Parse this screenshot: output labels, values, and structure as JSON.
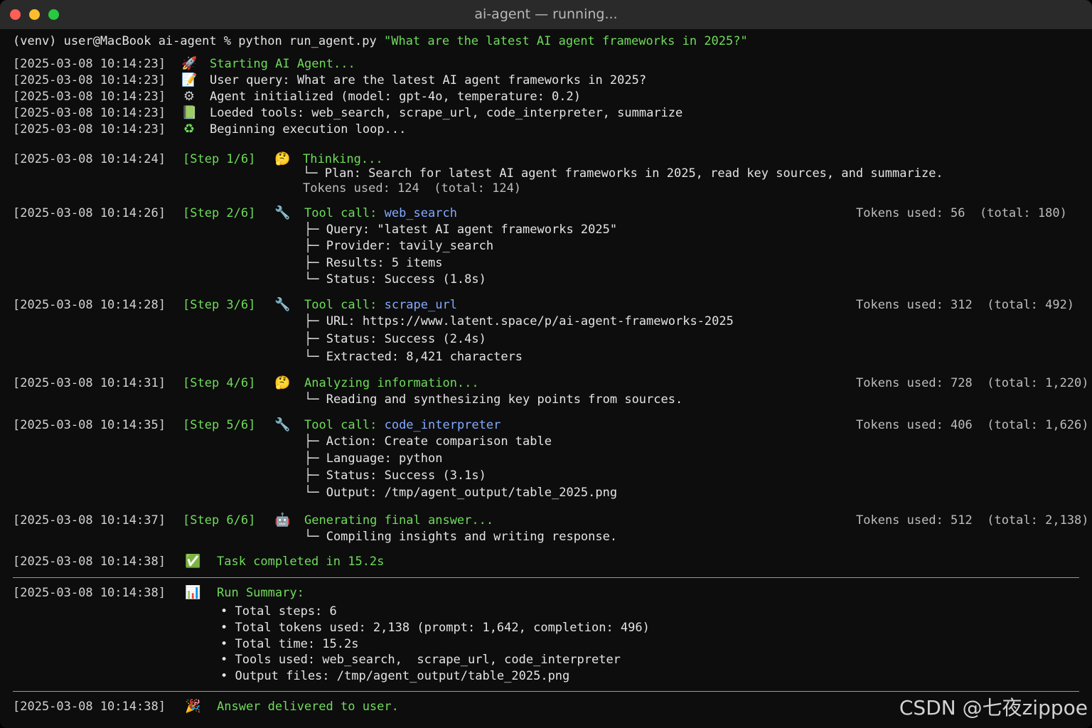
{
  "window": {
    "title": "ai-agent — running..."
  },
  "prompt": {
    "text": "(venv) user@MacBook ai-agent % python run_agent.py ",
    "arg": "\"What are the latest AI agent frameworks in 2025?\""
  },
  "init": [
    {
      "ts": "[2025-03-08 10:14:23]",
      "icon": "rocket-icon",
      "glyph": "🚀",
      "text": "Starting AI Agent...",
      "color": "green"
    },
    {
      "ts": "[2025-03-08 10:14:23]",
      "icon": "memo-icon",
      "glyph": "📝",
      "text": "User query: What are the latest AI agent frameworks in 2025?",
      "color": "white"
    },
    {
      "ts": "[2025-03-08 10:14:23]",
      "icon": "gear-icon",
      "glyph": "⚙",
      "text": "Agent initialized (model: gpt-4o, temperature: 0.2)",
      "color": "white"
    },
    {
      "ts": "[2025-03-08 10:14:23]",
      "icon": "book-icon",
      "glyph": "📗",
      "text": "Loeded tools: web_search, scrape_url, code_interpreter, summarize",
      "color": "white"
    },
    {
      "ts": "[2025-03-08 10:14:23]",
      "icon": "loop-icon",
      "glyph": "♻",
      "text": "Beginning execution loop...",
      "color": "white"
    }
  ],
  "steps": [
    {
      "ts": "[2025-03-08 10:14:24]",
      "step": "[Step 1/6]",
      "icon": "thinking-face-icon",
      "glyph": "🤔",
      "head": "Thinking...",
      "tool": "",
      "tokens": "",
      "details": [
        "└─ Plan: Search for latest AI agent frameworks in 2025, read key sources, and summarize.",
        "Tokens used: 124  (total: 124)"
      ]
    },
    {
      "ts": "[2025-03-08 10:14:26]",
      "step": "[Step 2/6]",
      "icon": "wrench-icon",
      "glyph": "🔧",
      "head": "Tool call: ",
      "tool": "web_search",
      "tokens": "Tokens used: 56  (total: 180)",
      "details": [
        "├─ Query: \"latest AI agent frameworks 2025\"",
        "├─ Provider: tavily_search",
        "├─ Results: 5 items",
        "└─ Status: Success (1.8s)"
      ]
    },
    {
      "ts": "[2025-03-08 10:14:28]",
      "step": "[Step 3/6]",
      "icon": "wrench-icon",
      "glyph": "🔧",
      "head": "Tool call: ",
      "tool": "scrape_url",
      "tokens": "Tokens used: 312  (total: 492)",
      "details": [
        "├─ URL: https://www.latent.space/p/ai-agent-frameworks-2025",
        "├─ Status: Success (2.4s)",
        "└─ Extracted: 8,421 characters"
      ]
    },
    {
      "ts": "[2025-03-08 10:14:31]",
      "step": "[Step 4/6]",
      "icon": "thinking-face-icon",
      "glyph": "🤔",
      "head": "Analyzing information...",
      "tool": "",
      "tokens": "Tokens used: 728  (total: 1,220)",
      "details": [
        "└─ Reading and synthesizing key points from sources."
      ]
    },
    {
      "ts": "[2025-03-08 10:14:35]",
      "step": "[Step 5/6]",
      "icon": "wrench-icon",
      "glyph": "🔧",
      "head": "Tool call: ",
      "tool": "code_interpreter",
      "tokens": "Tokens used: 406  (total: 1,626)",
      "details": [
        "├─ Action: Create comparison table",
        "├─ Language: python",
        "├─ Status: Success (3.1s)",
        "└─ Output: /tmp/agent_output/table_2025.png"
      ]
    },
    {
      "ts": "[2025-03-08 10:14:37]",
      "step": "[Step 6/6]",
      "icon": "robot-icon",
      "glyph": "🤖",
      "head": "Generating final answer...",
      "tool": "",
      "tokens": "Tokens used: 512  (total: 2,138)",
      "details": [
        "└─ Compiling insights and writing response."
      ]
    }
  ],
  "completed": {
    "ts": "[2025-03-08 10:14:38]",
    "icon": "check-mark-icon",
    "glyph": "✅",
    "text": "Task completed in 15.2s"
  },
  "summary": {
    "ts": "[2025-03-08 10:14:38]",
    "icon": "bar-chart-icon",
    "glyph": "📊",
    "title": "Run Summary:",
    "items": [
      "• Total steps: 6",
      "• Total tokens used: 2,138 (prompt: 1,642, completion: 496)",
      "• Total time: 15.2s",
      "• Tools used: web_search,  scrape_url, code_interpreter",
      "• Output files: /tmp/agent_output/table_2025.png"
    ]
  },
  "delivered": {
    "ts": "[2025-03-08 10:14:38]",
    "icon": "party-popper-icon",
    "glyph": "🎉",
    "text": "Answer delivered to user."
  },
  "watermark": "CSDN @七夜zippoe",
  "colors": {
    "green": "#6fdc5a",
    "blue": "#82aaff",
    "text": "#e4e4e4",
    "background": "#0d0d0d"
  }
}
